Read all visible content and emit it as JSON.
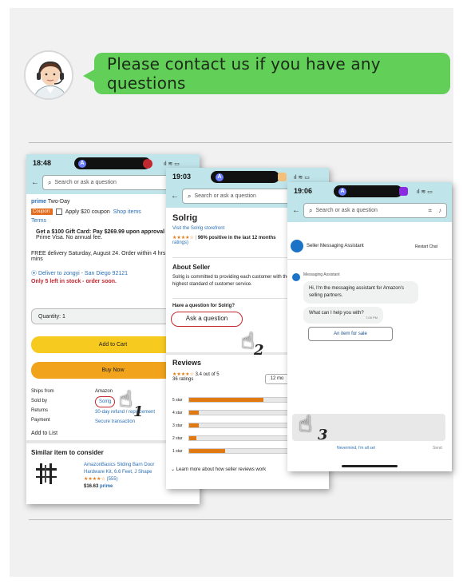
{
  "headline": "Please contact us if you have any questions",
  "phone1": {
    "time": "18:48",
    "island_letter": "A",
    "search_placeholder": "Search or ask a question",
    "prime_label": "prime",
    "prime_sub": "Two-Day",
    "coupon_badge": "Coupon:",
    "coupon_text": "Apply $20 coupon",
    "coupon_link": "Shop items",
    "terms": "Terms",
    "gift_card": "Get a $100 Gift Card: Pay $269.99 upon approval for",
    "gift_card2": "Prime Visa. No annual fee.",
    "delivery": "FREE delivery Saturday, August 24. Order within 4 hrs 26",
    "delivery2": "mins",
    "deliver_to": "Deliver to zongyi - San Diego 92121",
    "stock": "Only 5 left in stock - order soon.",
    "quantity": "Quantity: 1",
    "add_to_cart": "Add to Cart",
    "buy_now": "Buy Now",
    "ships_from_label": "Ships from",
    "ships_from": "Amazon",
    "sold_by_label": "Sold by",
    "sold_by": "Solrig",
    "returns_label": "Returns",
    "returns": "30-day refund / replacement",
    "payment_label": "Payment",
    "payment": "Secure transaction",
    "add_to_list": "Add to List",
    "similar_title": "Similar item to consider",
    "similar_name": "AmazonBasics Sliding Barn Door",
    "similar_name2": "Hardware Kit, 6.6 Feet, J Shape",
    "similar_stars": "★★★★☆",
    "similar_count": "(555)",
    "similar_price": "$16.63",
    "similar_prime": "prime",
    "step": "1"
  },
  "phone2": {
    "time": "19:03",
    "island_letter": "A",
    "search_placeholder": "Search or ask a question",
    "store_name": "Solrig",
    "visit_store": "Visit the Solrig storefront",
    "rating_stars": "★★★★☆",
    "rating_text": "96% positive in the last 12 months",
    "rating_count": "ratings)",
    "about_title": "About Seller",
    "about_text": "Solrig is committed to providing each customer with the",
    "about_text2": "highest standard of customer service.",
    "question_prompt": "Have a question for Solrig?",
    "ask_button": "Ask a question",
    "reviews_title": "Reviews",
    "reviews_stars": "★★★★☆",
    "reviews_score": "3.4 out of 5",
    "reviews_count": "36 ratings",
    "reviews_filter": "12 mo",
    "star_labels": [
      "5 star",
      "4 star",
      "3 star",
      "2 star",
      "1 star"
    ],
    "star_fractions": [
      0.62,
      0.08,
      0.08,
      0.06,
      0.3
    ],
    "learn_more": "Learn more about how seller reviews work",
    "step": "2"
  },
  "phone3": {
    "time": "19:06",
    "island_letter": "A",
    "search_placeholder": "Search or ask a question",
    "assistant_name": "Seller Messaging Assistant",
    "restart_chat": "Restart Chat",
    "msg_sender": "Messaging Assistant",
    "msg1": "Hi, I'm the messaging assistant for Amazon's selling partners.",
    "msg2": "What can I help you with?",
    "msg2_time": "7:05 PM",
    "option": "An item for sale",
    "nevermind": "Nevermind, I'm all set",
    "send": "Send",
    "step": "3"
  }
}
